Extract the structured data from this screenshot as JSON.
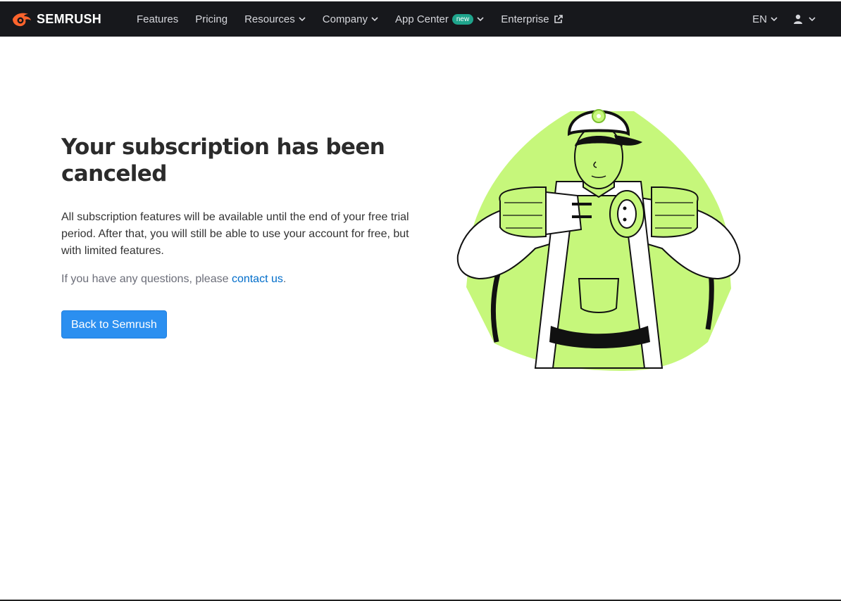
{
  "header": {
    "logo_text": "SEMRUSH",
    "nav": [
      {
        "label": "Features"
      },
      {
        "label": "Pricing"
      },
      {
        "label": "Resources"
      },
      {
        "label": "Company"
      },
      {
        "label": "App Center",
        "badge": "new"
      },
      {
        "label": "Enterprise"
      }
    ],
    "language": "EN"
  },
  "main": {
    "title": "Your subscription has been canceled",
    "description": "All subscription features will be available until the end of your free trial period. After that, you will still be able to use your account for free, but with limited features.",
    "question_prefix": "If you have any questions, please ",
    "contact_link": "contact us",
    "question_suffix": ".",
    "back_button": "Back to Semrush"
  },
  "colors": {
    "header_bg": "#17181c",
    "brand_orange": "#ff642d",
    "button_blue": "#2b8ff0",
    "link_blue": "#006dca",
    "illustration_green": "#c6f77b",
    "badge_green": "#1fa48c"
  }
}
